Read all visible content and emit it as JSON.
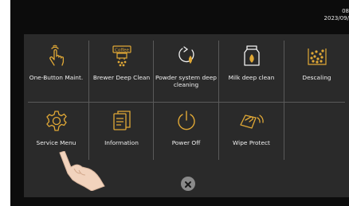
{
  "clock": {
    "time": "08",
    "date": "2023/09/"
  },
  "menu": {
    "row1": [
      {
        "label": "One-Button Maint.",
        "icon": "hand-tap-icon"
      },
      {
        "label": "Brewer Deep Clean",
        "icon": "brewer-icon",
        "icon_text": "Coffee"
      },
      {
        "label": "Powder system deep cleaning",
        "icon": "powder-clean-icon"
      },
      {
        "label": "Milk deep clean",
        "icon": "milk-carton-icon"
      },
      {
        "label": "Descaling",
        "icon": "descaling-icon"
      }
    ],
    "row2": [
      {
        "label": "Service Menu",
        "icon": "gear-icon"
      },
      {
        "label": "Information",
        "icon": "document-icon"
      },
      {
        "label": "Power Off",
        "icon": "power-icon"
      },
      {
        "label": "Wipe Protect",
        "icon": "wipe-hand-icon"
      }
    ]
  },
  "close": {
    "icon": "close-icon"
  },
  "colors": {
    "accent": "#e0a836",
    "panel": "#2a2a2a",
    "background": "#0c0c0c",
    "text": "#f0f0f0"
  }
}
